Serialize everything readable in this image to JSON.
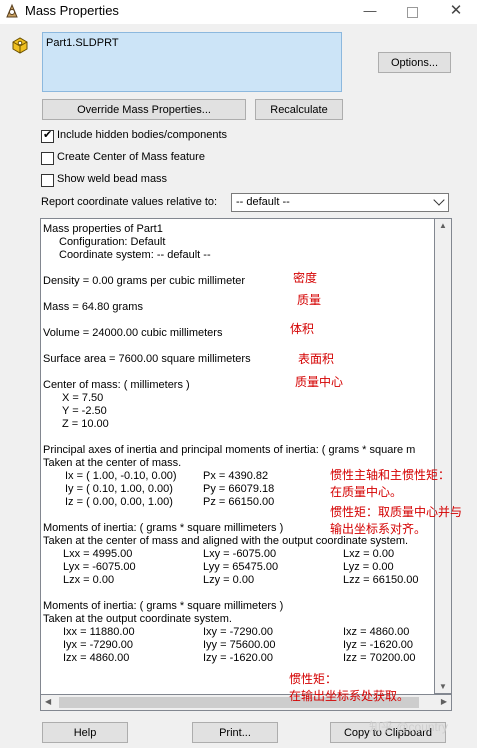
{
  "window": {
    "title": "Mass Properties",
    "minimize_glyph": "—",
    "close_glyph": "✕"
  },
  "icons": {
    "app": "solidworks-icon",
    "part": "part-icon"
  },
  "selection": {
    "items": [
      "Part1.SLDPRT"
    ]
  },
  "buttons": {
    "options": "Options...",
    "override": "Override Mass Properties...",
    "recalculate": "Recalculate",
    "help": "Help",
    "print": "Print...",
    "copy": "Copy to Clipboard"
  },
  "checkboxes": [
    {
      "label": "Include hidden bodies/components",
      "checked": true
    },
    {
      "label": "Create Center of Mass feature",
      "checked": false
    },
    {
      "label": "Show weld bead mass",
      "checked": false
    }
  ],
  "report_coords": {
    "label": "Report coordinate values relative to:",
    "value": "-- default --"
  },
  "results": {
    "header": "Mass properties of Part1",
    "configuration": "Configuration: Default",
    "coordinate_system": "Coordinate system: -- default --",
    "density": "Density = 0.00 grams per cubic millimeter",
    "mass": "Mass = 64.80 grams",
    "volume": "Volume = 24000.00 cubic millimeters",
    "surface_area": "Surface area = 7600.00  square millimeters",
    "center_title": "Center of mass: ( millimeters )",
    "cx": "X = 7.50",
    "cy": "Y = -2.50",
    "cz": "Z = 10.00",
    "principal_title": "Principal axes of inertia and principal moments of inertia: ( grams *  square m",
    "principal_sub": "Taken at the center of mass.",
    "ix": "Ix = ( 1.00, -0.10,  0.00)",
    "iy": "Iy = ( 0.10,  1.00,  0.00)",
    "iz": "Iz = ( 0.00,  0.00,  1.00)",
    "px": "Px = 4390.82",
    "py": "Py = 66079.18",
    "pz": "Pz = 66150.00",
    "moments1_title": "Moments of inertia: ( grams *  square millimeters )",
    "moments1_sub": "Taken at the center of mass and aligned with the output coordinate system.",
    "m1": [
      [
        "Lxx = 4995.00",
        "Lxy = -6075.00",
        "Lxz = 0.00"
      ],
      [
        "Lyx = -6075.00",
        "Lyy = 65475.00",
        "Lyz = 0.00"
      ],
      [
        "Lzx = 0.00",
        "Lzy = 0.00",
        "Lzz = 66150.00"
      ]
    ],
    "moments2_title": "Moments of inertia: ( grams *  square millimeters )",
    "moments2_sub": "Taken at the output coordinate system.",
    "m2": [
      [
        "Ixx = 11880.00",
        "Ixy = -7290.00",
        "Ixz = 4860.00"
      ],
      [
        "Iyx = -7290.00",
        "Iyy = 75600.00",
        "Iyz = -1620.00"
      ],
      [
        "Izx = 4860.00",
        "Izy = -1620.00",
        "Izz = 70200.00"
      ]
    ]
  },
  "annotations": {
    "density": "密度",
    "mass": "质量",
    "volume": "体积",
    "surface_area": "表面积",
    "center": "质量中心",
    "principal_1": "惯性主轴和主惯性矩：",
    "principal_2": "在质量中心。",
    "inertia_com_1": "惯性矩：取质量中心并与",
    "inertia_com_2": "输出坐标系对齐。",
    "inertia_out_1": "惯性矩：",
    "inertia_out_2": "在输出坐标系处获取。"
  },
  "watermark": "知乎 @country",
  "colors": {
    "annotation": "#d40000",
    "selection_bg": "#cce4f7"
  }
}
